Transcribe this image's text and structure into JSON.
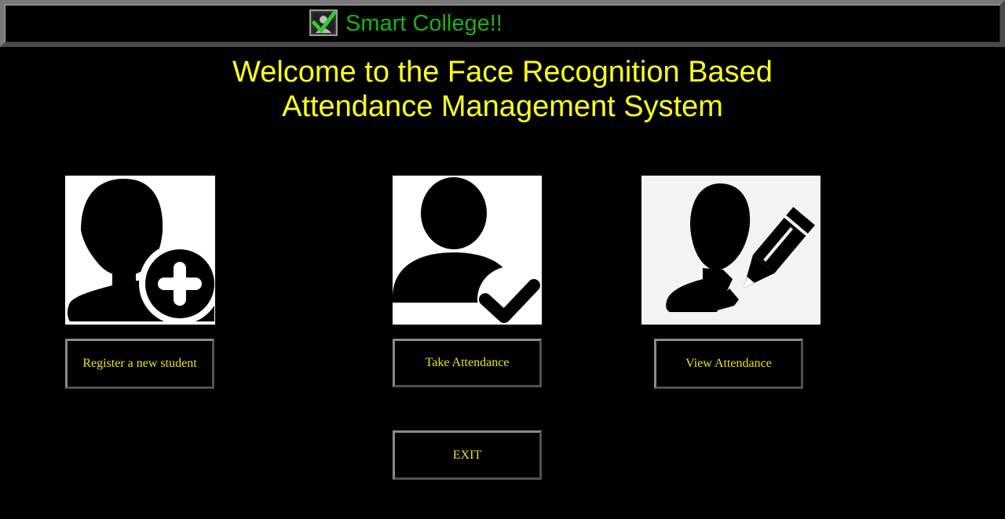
{
  "window": {
    "title": "Smart College!!",
    "logo_icon": "checkbox-check-icon",
    "title_color": "#1bb01b"
  },
  "welcome": {
    "line1": "Welcome to the Face Recognition Based",
    "line2": "Attendance Management System",
    "color": "#ffff1a"
  },
  "tiles": [
    {
      "icon": "user-add-icon",
      "label": "Register a new student"
    },
    {
      "icon": "user-check-icon",
      "label": "Take Attendance"
    },
    {
      "icon": "user-edit-icon",
      "label": "View Attendance"
    }
  ],
  "buttons": {
    "register": "Register a new student",
    "take": "Take Attendance",
    "view": "View Attendance",
    "exit": "EXIT",
    "text_color": "#e8e21a"
  }
}
